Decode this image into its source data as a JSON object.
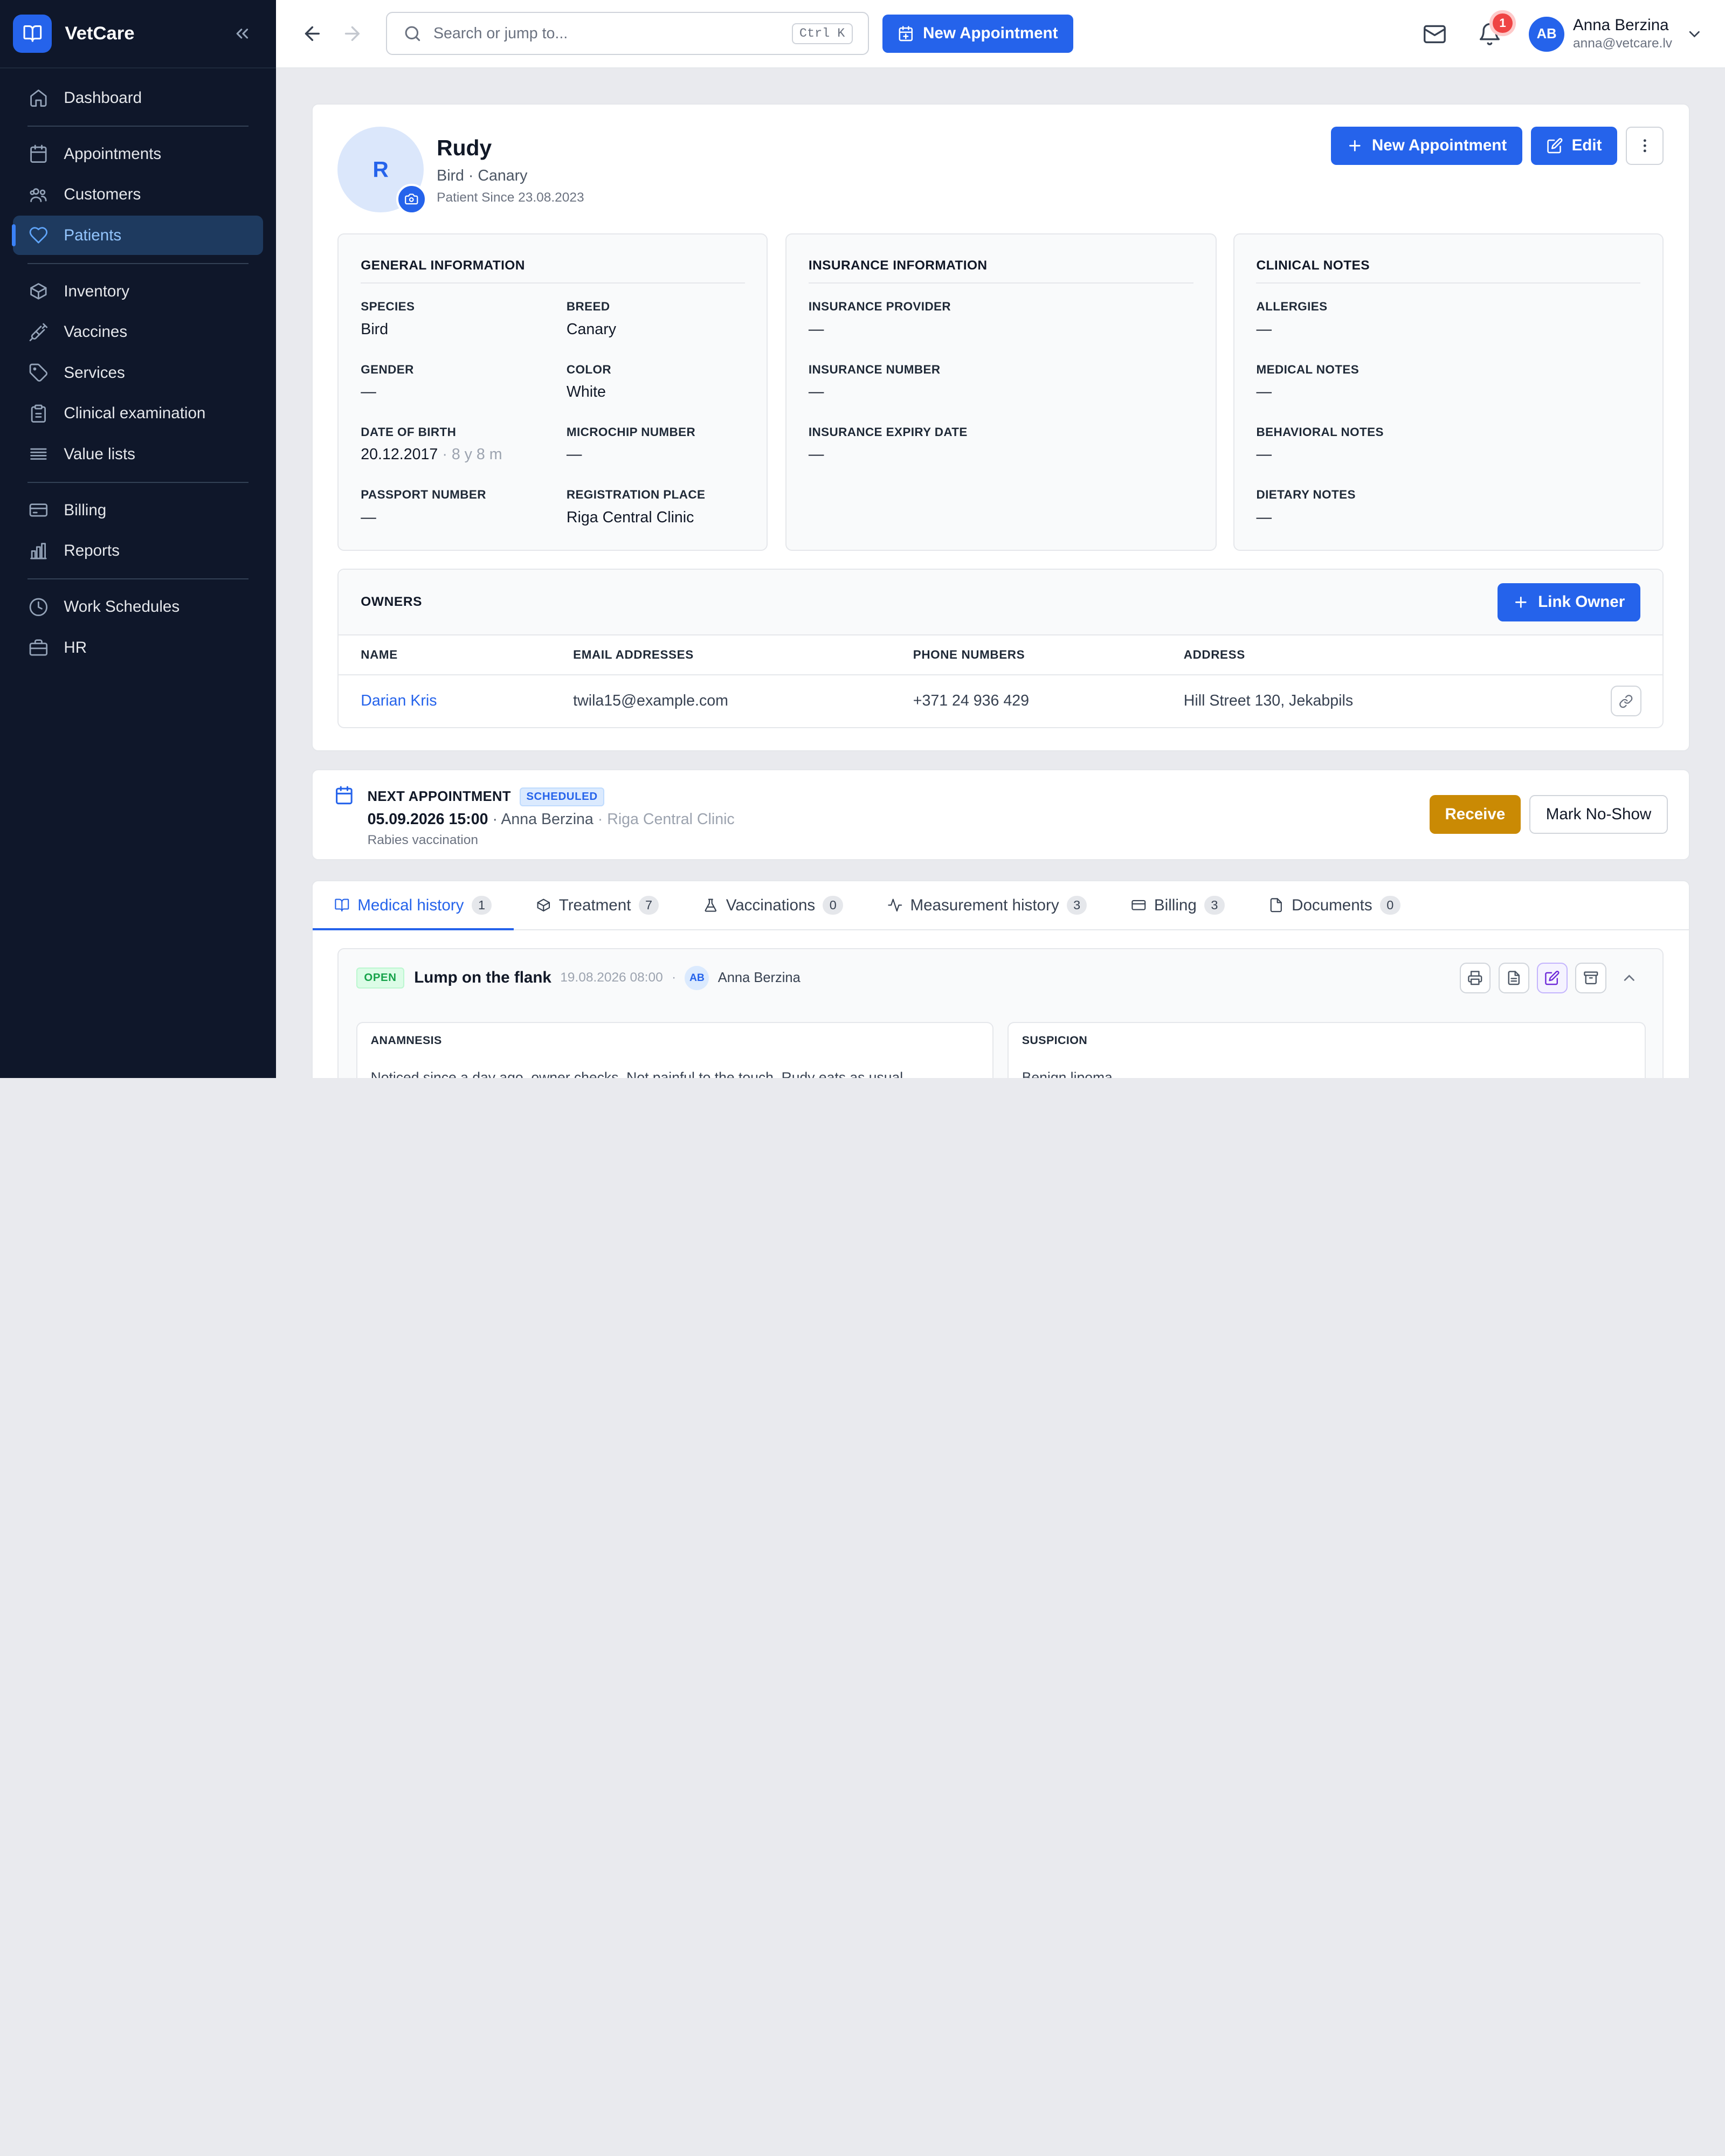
{
  "app": {
    "name": "VetCare"
  },
  "sidebar": {
    "groups": [
      [
        {
          "label": "Dashboard",
          "icon": "home-icon"
        }
      ],
      [
        {
          "label": "Appointments",
          "icon": "calendar-icon"
        },
        {
          "label": "Customers",
          "icon": "users-icon"
        },
        {
          "label": "Patients",
          "icon": "heart-icon",
          "active": true
        }
      ],
      [
        {
          "label": "Inventory",
          "icon": "box-icon"
        },
        {
          "label": "Vaccines",
          "icon": "syringe-icon"
        },
        {
          "label": "Services",
          "icon": "tag-icon"
        },
        {
          "label": "Clinical examination",
          "icon": "clipboard-icon"
        },
        {
          "label": "Value lists",
          "icon": "list-icon"
        }
      ],
      [
        {
          "label": "Billing",
          "icon": "credit-card-icon"
        },
        {
          "label": "Reports",
          "icon": "bar-chart-icon"
        }
      ],
      [
        {
          "label": "Work Schedules",
          "icon": "clock-icon"
        },
        {
          "label": "HR",
          "icon": "briefcase-icon"
        }
      ]
    ]
  },
  "topbar": {
    "search_placeholder": "Search or jump to...",
    "search_shortcut": "Ctrl K",
    "new_appointment": "New Appointment",
    "notification_count": "1",
    "user": {
      "initials": "AB",
      "name": "Anna Berzina",
      "email": "anna@vetcare.lv"
    }
  },
  "patient": {
    "initial": "R",
    "name": "Rudy",
    "subtitle": "Bird · Canary",
    "since": "Patient Since 23.08.2023",
    "actions": {
      "new_appointment": "New Appointment",
      "edit": "Edit"
    }
  },
  "general": {
    "title": "GENERAL INFORMATION",
    "fields": [
      {
        "label": "SPECIES",
        "value": "Bird"
      },
      {
        "label": "BREED",
        "value": "Canary"
      },
      {
        "label": "GENDER",
        "value": "—"
      },
      {
        "label": "COLOR",
        "value": "White"
      },
      {
        "label": "DATE OF BIRTH",
        "value": "20.12.2017",
        "extra": "· 8 y 8 m"
      },
      {
        "label": "MICROCHIP NUMBER",
        "value": "—"
      },
      {
        "label": "PASSPORT NUMBER",
        "value": "—"
      },
      {
        "label": "REGISTRATION PLACE",
        "value": "Riga Central Clinic"
      }
    ]
  },
  "insurance": {
    "title": "INSURANCE INFORMATION",
    "fields": [
      {
        "label": "INSURANCE PROVIDER",
        "value": "—"
      },
      {
        "label": "INSURANCE NUMBER",
        "value": "—"
      },
      {
        "label": "INSURANCE EXPIRY DATE",
        "value": "—"
      }
    ]
  },
  "clinical": {
    "title": "CLINICAL NOTES",
    "fields": [
      {
        "label": "ALLERGIES",
        "value": "—"
      },
      {
        "label": "MEDICAL NOTES",
        "value": "—"
      },
      {
        "label": "BEHAVIORAL NOTES",
        "value": "—"
      },
      {
        "label": "DIETARY NOTES",
        "value": "—"
      }
    ]
  },
  "owners": {
    "title": "OWNERS",
    "link_button": "Link Owner",
    "columns": [
      "NAME",
      "EMAIL ADDRESSES",
      "PHONE NUMBERS",
      "ADDRESS"
    ],
    "rows": [
      {
        "name": "Darian Kris",
        "email": "twila15@example.com",
        "phone": "+371 24 936 429",
        "address": "Hill Street 130, Jekabpils"
      }
    ]
  },
  "next_appointment": {
    "label": "NEXT APPOINTMENT",
    "status": "SCHEDULED",
    "datetime": "05.09.2026 15:00",
    "doctor": "· Anna Berzina",
    "clinic": "· Riga Central Clinic",
    "note": "Rabies vaccination",
    "receive": "Receive",
    "no_show": "Mark No-Show"
  },
  "tabs": [
    {
      "label": "Medical history",
      "count": "1",
      "icon": "book-icon",
      "active": true
    },
    {
      "label": "Treatment",
      "count": "7",
      "icon": "cube-icon"
    },
    {
      "label": "Vaccinations",
      "count": "0",
      "icon": "flask-icon"
    },
    {
      "label": "Measurement history",
      "count": "3",
      "icon": "activity-icon"
    },
    {
      "label": "Billing",
      "count": "3",
      "icon": "card-icon"
    },
    {
      "label": "Documents",
      "count": "0",
      "icon": "document-icon"
    }
  ],
  "record": {
    "status": "OPEN",
    "title": "Lump on the flank",
    "date": "19.08.2026 08:00",
    "author_initials": "AB",
    "author": "Anna Berzina",
    "anamnesis_label": "ANAMNESIS",
    "anamnesis_text": "Noticed since a day ago, owner checks. Not painful to the touch. Rudy eats as usual.",
    "suspicion_label": "SUSPICION",
    "suspicion_text": "Benign lipoma"
  },
  "colors": {
    "accent": "#2563eb",
    "sidebar": "#0f172a",
    "receive": "#ca8a04",
    "open": "#16a34a"
  }
}
